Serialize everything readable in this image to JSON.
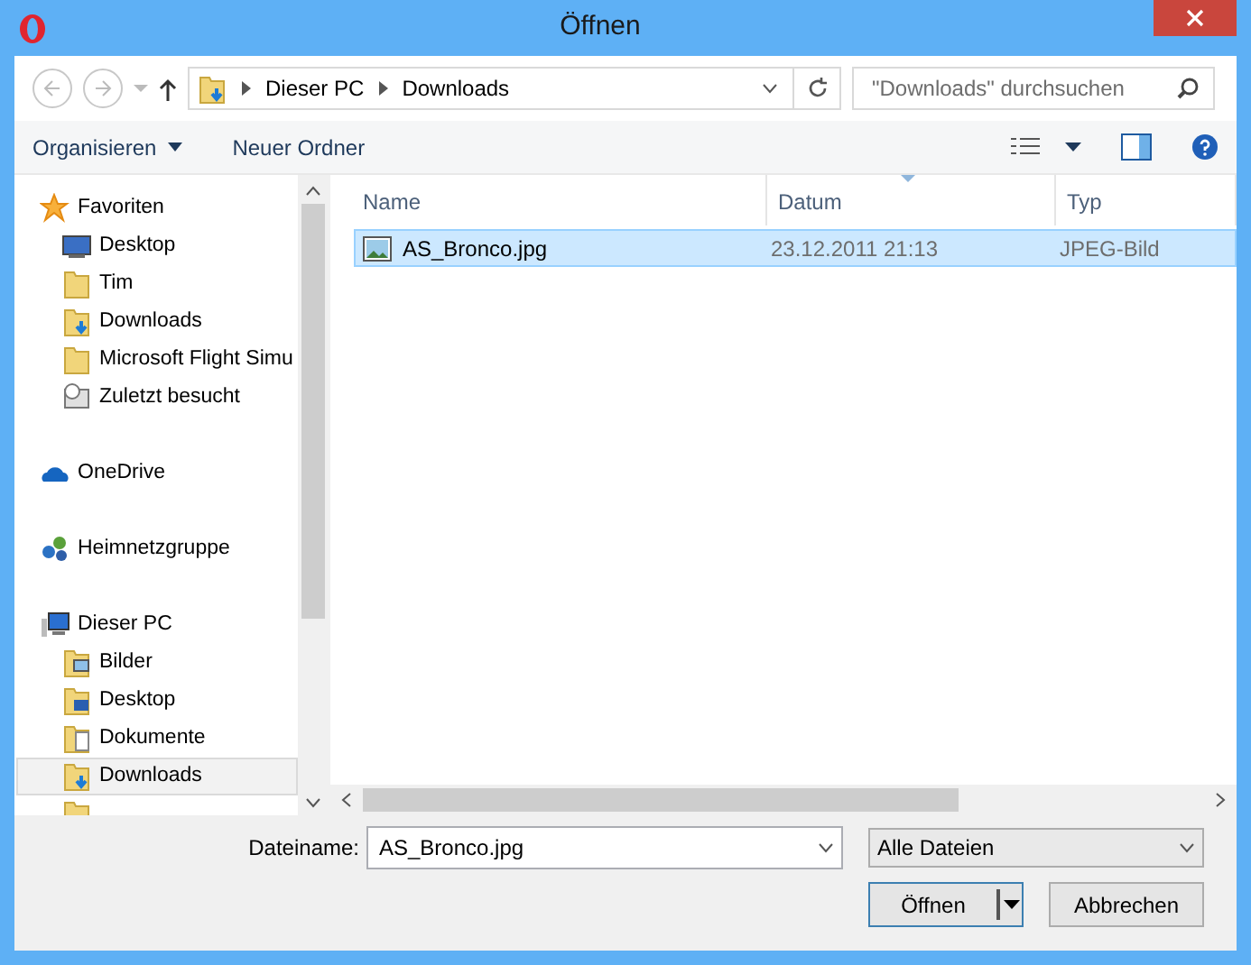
{
  "window": {
    "title": "Öffnen"
  },
  "address": {
    "path": [
      "Dieser PC",
      "Downloads"
    ],
    "search_placeholder": "\"Downloads\" durchsuchen"
  },
  "toolbar": {
    "organize": "Organisieren",
    "new_folder": "Neuer Ordner"
  },
  "nav": [
    {
      "label": "Favoriten",
      "kind": "star",
      "selected": false,
      "children": [
        {
          "label": "Desktop",
          "kind": "desktop",
          "selected": false
        },
        {
          "label": "Tim",
          "kind": "folder",
          "selected": false
        },
        {
          "label": "Downloads",
          "kind": "download",
          "selected": false
        },
        {
          "label": "Microsoft Flight Simu",
          "kind": "folder",
          "selected": false
        },
        {
          "label": "Zuletzt besucht",
          "kind": "recent",
          "selected": false
        }
      ]
    },
    {
      "label": "OneDrive",
      "kind": "cloud",
      "selected": false
    },
    {
      "label": "Heimnetzgruppe",
      "kind": "network",
      "selected": false
    },
    {
      "label": "Dieser PC",
      "kind": "pc",
      "selected": false,
      "children": [
        {
          "label": "Bilder",
          "kind": "pictures",
          "selected": false
        },
        {
          "label": "Desktop",
          "kind": "desktop-folder",
          "selected": false
        },
        {
          "label": "Dokumente",
          "kind": "documents",
          "selected": false
        },
        {
          "label": "Downloads",
          "kind": "download",
          "selected": true
        },
        {
          "kind": "folder",
          "selected": false
        }
      ]
    }
  ],
  "files": {
    "columns": [
      {
        "label": "Name",
        "sorted": false
      },
      {
        "label": "Datum",
        "sorted": true
      },
      {
        "label": "Typ",
        "sorted": false
      }
    ],
    "rows": [
      {
        "name": "AS_Bronco.jpg",
        "date": "23.12.2011 21:13",
        "type": "JPEG-Bild",
        "selected": true
      }
    ]
  },
  "footer": {
    "filename_label": "Dateiname:",
    "filename": "AS_Bronco.jpg",
    "filter": "Alle Dateien",
    "open": "Öffnen",
    "cancel": "Abbrechen"
  }
}
